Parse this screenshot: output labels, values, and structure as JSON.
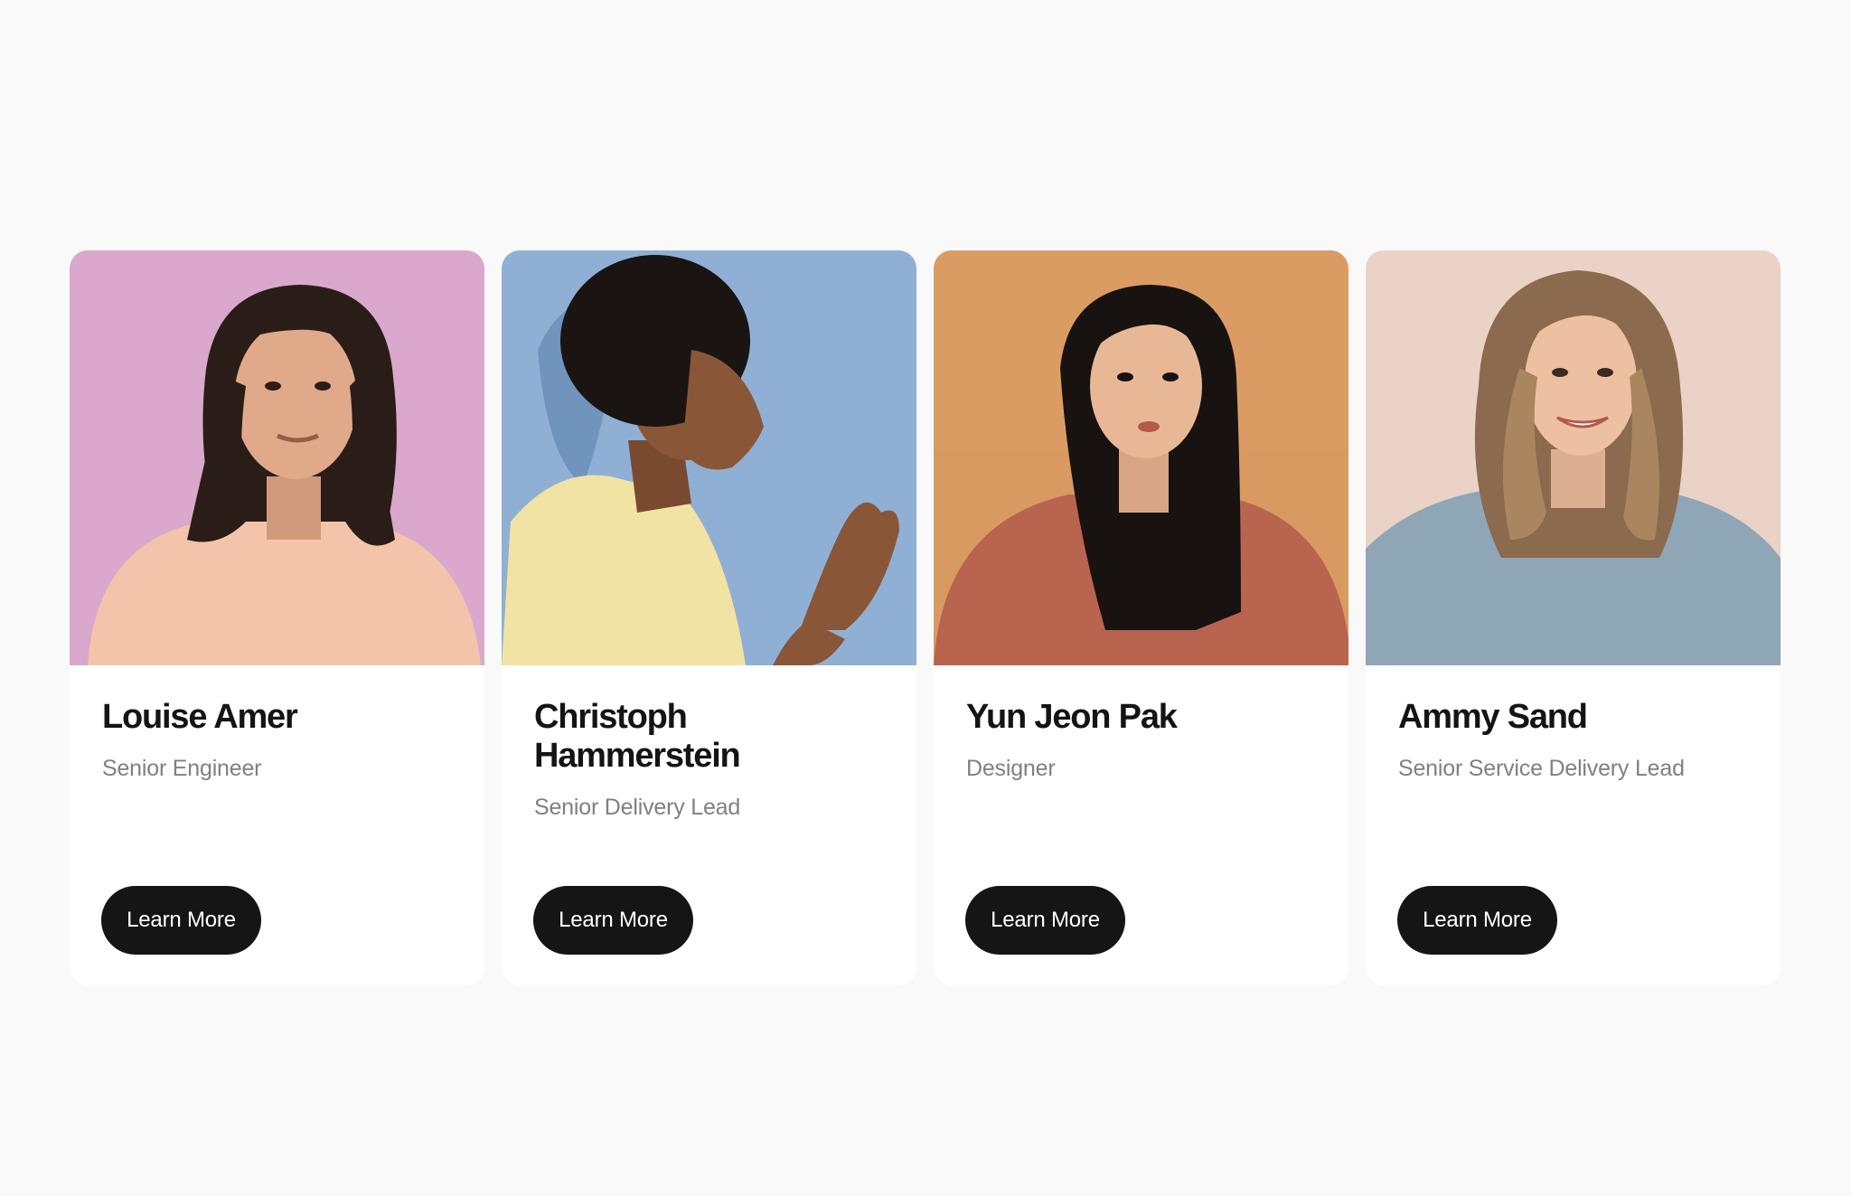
{
  "team": [
    {
      "name": "Louise Amer",
      "role": "Senior Engineer",
      "button": "Learn More",
      "photo_bg": "#dcaed0",
      "photo_icon": "portrait-woman-pink-background"
    },
    {
      "name": "Christoph Hammerstein",
      "role": "Senior Delivery Lead",
      "button": "Learn More",
      "photo_bg": "#8fb0d4",
      "photo_icon": "portrait-man-blue-background"
    },
    {
      "name": "Yun Jeon Pak",
      "role": "Designer",
      "button": "Learn More",
      "photo_bg": "#d99a62",
      "photo_icon": "portrait-woman-orange-background"
    },
    {
      "name": "Ammy Sand",
      "role": "Senior Service Delivery Lead",
      "button": "Learn More",
      "photo_bg": "#ead2c6",
      "photo_icon": "portrait-woman-beige-background"
    }
  ],
  "colors": {
    "page_bg": "#f9f9f9",
    "card_bg": "#ffffff",
    "button_bg": "#151515",
    "name_text": "#141414",
    "role_text": "#808080"
  }
}
